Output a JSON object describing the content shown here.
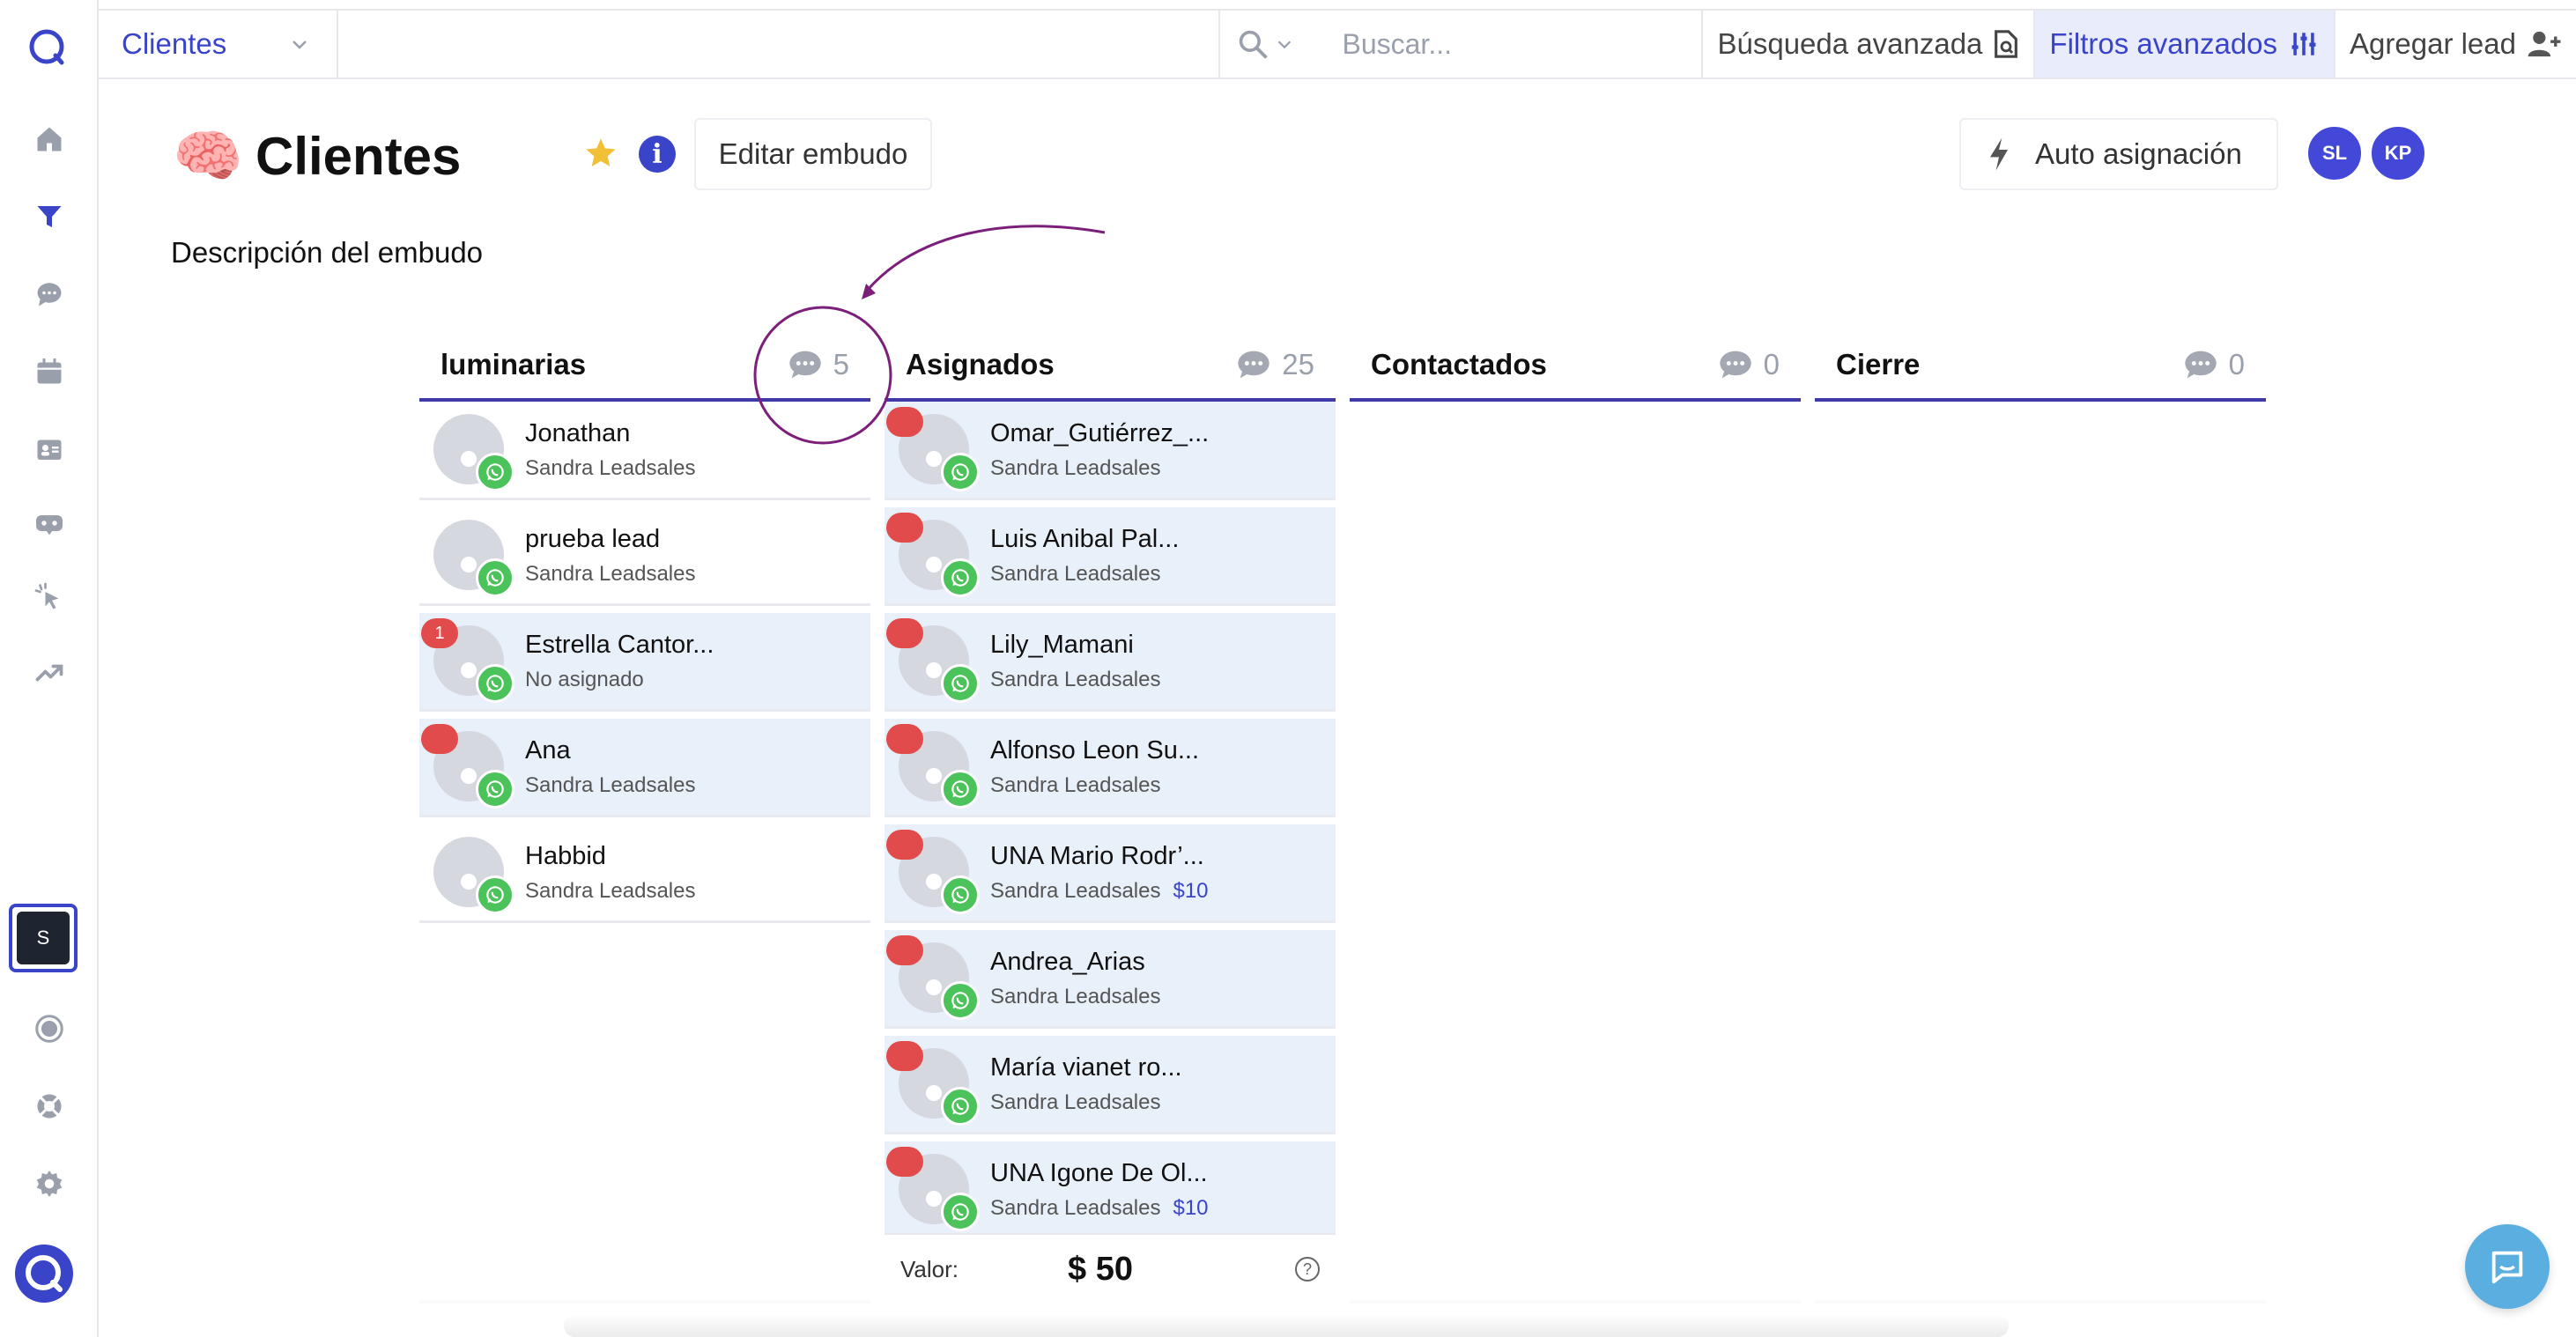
{
  "topbar": {
    "funnel_selector": "Clientes",
    "search_placeholder": "Buscar...",
    "advanced_search_label": "Búsqueda avanzada",
    "advanced_filters_label": "Filtros avanzados",
    "add_lead_label": "Agregar lead"
  },
  "header": {
    "emoji": "🧠",
    "title": "Clientes",
    "edit_button": "Editar embudo",
    "auto_assign_button": "Auto asignación",
    "avatars": [
      "SL",
      "KP"
    ],
    "description": "Descripción del embudo"
  },
  "sidebar": {
    "workspace_initial": "S",
    "icons": [
      "logo-icon",
      "home-icon",
      "funnel-icon",
      "chat-icon",
      "calendar-icon",
      "contacts-icon",
      "bot-icon",
      "click-icon",
      "trending-icon",
      "whatsapp-icon",
      "support-icon",
      "settings-icon"
    ]
  },
  "columns": [
    {
      "title": "luminarias",
      "count": "5",
      "cards": [
        {
          "name": "Jonathan",
          "owner": "Sandra Leadsales",
          "badge": "",
          "value": "",
          "highlight": false
        },
        {
          "name": "prueba lead",
          "owner": "Sandra Leadsales",
          "badge": "",
          "value": "",
          "highlight": false
        },
        {
          "name": "Estrella Cantor...",
          "owner": "No asignado",
          "badge": "1",
          "value": "",
          "highlight": true
        },
        {
          "name": "Ana",
          "owner": "Sandra Leadsales",
          "badge": " ",
          "value": "",
          "highlight": true
        },
        {
          "name": "Habbid",
          "owner": "Sandra Leadsales",
          "badge": "",
          "value": "",
          "highlight": false
        }
      ]
    },
    {
      "title": "Asignados",
      "count": "25",
      "cards": [
        {
          "name": "Omar_Gutiérrez_...",
          "owner": "Sandra Leadsales",
          "badge": " ",
          "value": "",
          "highlight": true
        },
        {
          "name": "Luis Anibal Pal...",
          "owner": "Sandra Leadsales",
          "badge": " ",
          "value": "",
          "highlight": true
        },
        {
          "name": "Lily_Mamani",
          "owner": "Sandra Leadsales",
          "badge": " ",
          "value": "",
          "highlight": true
        },
        {
          "name": "Alfonso Leon Su...",
          "owner": "Sandra Leadsales",
          "badge": " ",
          "value": "",
          "highlight": true
        },
        {
          "name": "UNA Mario Rodr’...",
          "owner": "Sandra Leadsales",
          "badge": " ",
          "value": "$10",
          "highlight": true
        },
        {
          "name": "Andrea_Arias",
          "owner": "Sandra Leadsales",
          "badge": " ",
          "value": "",
          "highlight": true
        },
        {
          "name": "María vianet ro...",
          "owner": "Sandra Leadsales",
          "badge": " ",
          "value": "",
          "highlight": true
        },
        {
          "name": "UNA Igone De Ol...",
          "owner": "Sandra Leadsales",
          "badge": " ",
          "value": "$10",
          "highlight": true
        }
      ],
      "footer": {
        "label": "Valor:",
        "amount": "$ 50"
      }
    },
    {
      "title": "Contactados",
      "count": "0",
      "cards": []
    },
    {
      "title": "Cierre",
      "count": "0",
      "cards": []
    }
  ],
  "colors": {
    "accent": "#3944c9",
    "column_underline": "#3f3aa8",
    "annotation": "#7b1f7a",
    "badge": "#e14b4b",
    "whatsapp": "#4cc35a",
    "highlight_card": "#e8f0fa"
  }
}
